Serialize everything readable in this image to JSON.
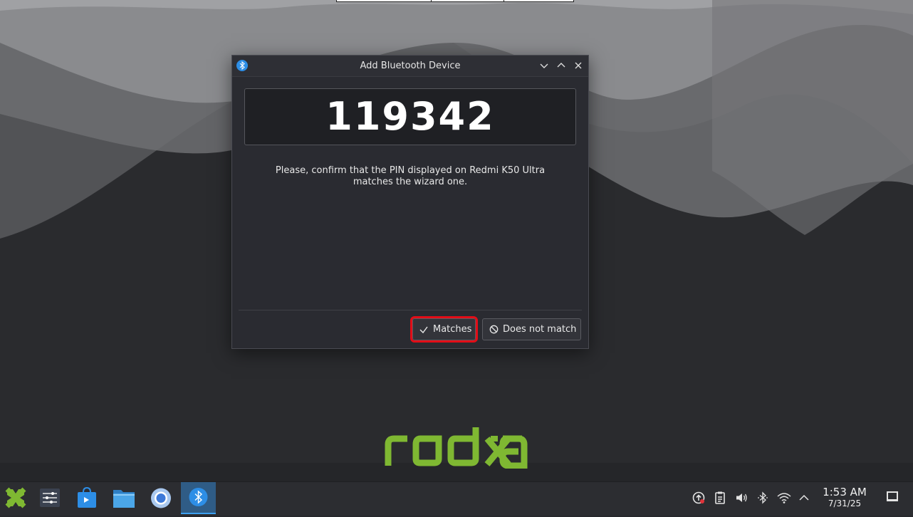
{
  "dialog": {
    "title": "Add Bluetooth Device",
    "app_icon": "bluetooth-icon",
    "window_buttons": [
      "minimize",
      "maximize",
      "close"
    ],
    "pin": "119342",
    "message": "Please, confirm that the PIN displayed on Redmi K50 Ultra matches the wizard one.",
    "buttons": {
      "matches": {
        "label": "Matches",
        "icon": "checkmark-icon"
      },
      "no_match": {
        "label": "Does not match",
        "icon": "cancel-icon"
      }
    },
    "highlight_color": "#e30d17"
  },
  "desktop": {
    "logo_text": "radxa",
    "logo_color": "#7fb832"
  },
  "taskbar": {
    "apps": [
      {
        "name": "app-launcher-icon"
      },
      {
        "name": "system-settings-icon"
      },
      {
        "name": "discover-store-icon"
      },
      {
        "name": "file-manager-icon"
      },
      {
        "name": "chromium-icon"
      },
      {
        "name": "bluetooth-wizard-icon",
        "active": true
      }
    ],
    "tray": [
      "updates-icon",
      "clipboard-icon",
      "volume-icon",
      "bluetooth-icon",
      "wifi-icon",
      "expand-tray-icon"
    ],
    "clock": {
      "time": "1:53 AM",
      "date": "7/31/25"
    },
    "accent": "#3da0f0"
  }
}
